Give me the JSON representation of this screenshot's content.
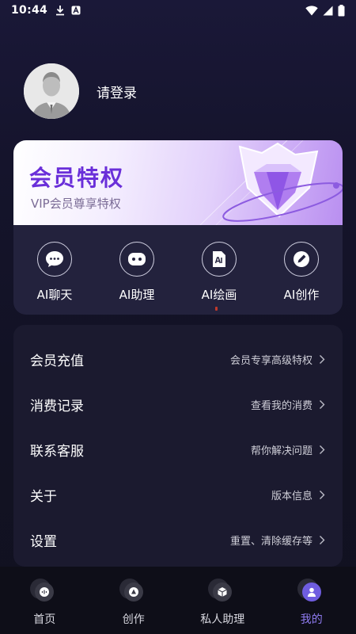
{
  "status_bar": {
    "time": "10:44",
    "icons": [
      "download-icon",
      "app-a-icon",
      "wifi-icon",
      "signal-icon",
      "battery-icon"
    ]
  },
  "profile": {
    "login_text": "请登录"
  },
  "vip": {
    "title": "会员特权",
    "subtitle": "VIP会员尊享特权"
  },
  "ai_features": [
    {
      "label": "AI聊天",
      "icon": "chat-bubble-icon"
    },
    {
      "label": "AI助理",
      "icon": "robot-face-icon"
    },
    {
      "label": "AI绘画",
      "icon": "ai-image-icon"
    },
    {
      "label": "AI创作",
      "icon": "pen-icon"
    }
  ],
  "menu": [
    {
      "title": "会员充值",
      "desc": "会员专享高级特权"
    },
    {
      "title": "消费记录",
      "desc": "查看我的消费"
    },
    {
      "title": "联系客服",
      "desc": "帮你解决问题"
    },
    {
      "title": "关于",
      "desc": "版本信息"
    },
    {
      "title": "设置",
      "desc": "重置、清除缓存等"
    }
  ],
  "tabs": [
    {
      "label": "首页",
      "icon": "home-voice-icon",
      "active": false
    },
    {
      "label": "创作",
      "icon": "create-icon",
      "active": false
    },
    {
      "label": "私人助理",
      "icon": "assistant-cube-icon",
      "active": false
    },
    {
      "label": "我的",
      "icon": "profile-icon",
      "active": true
    }
  ],
  "colors": {
    "accent": "#8f7bf0",
    "vip_title": "#6a2fd9",
    "background": "#15142c"
  }
}
